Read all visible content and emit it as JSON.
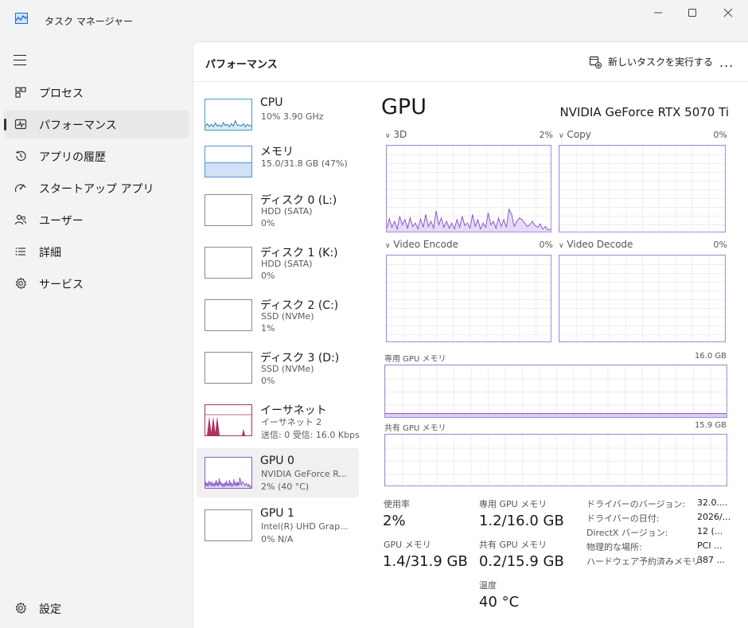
{
  "window": {
    "title": "タスク マネージャー",
    "controls": [
      "minimize-icon",
      "maximize-icon",
      "close-icon"
    ]
  },
  "nav": {
    "items": [
      {
        "label": "プロセス",
        "icon": "processes-icon"
      },
      {
        "label": "パフォーマンス",
        "icon": "performance-icon",
        "selected": true
      },
      {
        "label": "アプリの履歴",
        "icon": "history-icon"
      },
      {
        "label": "スタートアップ アプリ",
        "icon": "startup-icon"
      },
      {
        "label": "ユーザー",
        "icon": "users-icon"
      },
      {
        "label": "詳細",
        "icon": "details-icon"
      },
      {
        "label": "サービス",
        "icon": "services-icon"
      }
    ],
    "settings_label": "設定"
  },
  "header": {
    "title": "パフォーマンス",
    "run_task_label": "新しいタスクを実行する",
    "more_label": "..."
  },
  "resources": [
    {
      "name": "CPU",
      "sub1": "10%  3.90 GHz",
      "sub2": "",
      "sub3": "",
      "utilization": [
        0.12,
        0.2,
        0.1,
        0.18,
        0.1,
        0.22,
        0.12,
        0.16,
        0.1,
        0.24,
        0.14,
        0.18,
        0.1,
        0.2,
        0.12,
        0.3,
        0.14,
        0.16,
        0.12,
        0.2,
        0.1,
        0.18,
        0.12,
        0.14
      ]
    },
    {
      "name": "メモリ",
      "sub1": "15.0/31.8 GB (47%)",
      "sub2": "",
      "sub3": "",
      "utilization": [
        0.47
      ]
    },
    {
      "name": "ディスク 0 (L:)",
      "sub1": "HDD (SATA)",
      "sub2": "0%",
      "sub3": "",
      "utilization": []
    },
    {
      "name": "ディスク 1 (K:)",
      "sub1": "HDD (SATA)",
      "sub2": "0%",
      "sub3": "",
      "utilization": []
    },
    {
      "name": "ディスク 2 (C:)",
      "sub1": "SSD (NVMe)",
      "sub2": "1%",
      "sub3": "",
      "utilization": []
    },
    {
      "name": "ディスク 3 (D:)",
      "sub1": "SSD (NVMe)",
      "sub2": "0%",
      "sub3": "",
      "utilization": []
    },
    {
      "name": "イーサネット",
      "sub1": "イーサネット 2",
      "sub2": "送信: 0  受信: 16.0 Kbps",
      "sub3": "",
      "utilization": []
    },
    {
      "name": "GPU 0",
      "sub1": "NVIDIA GeForce R...",
      "sub2": "2% (40 °C)",
      "sub3": "",
      "selected": true,
      "utilization": []
    },
    {
      "name": "GPU 1",
      "sub1": "Intel(R) UHD Grap...",
      "sub2": "0%  N/A",
      "sub3": "",
      "utilization": []
    }
  ],
  "gpu": {
    "title": "GPU",
    "model": "NVIDIA GeForce RTX 5070 Ti",
    "engines": [
      {
        "label": "3D",
        "pct": "2%"
      },
      {
        "label": "Copy",
        "pct": "0%"
      },
      {
        "label": "Video Encode",
        "pct": "0%"
      },
      {
        "label": "Video Decode",
        "pct": "0%"
      }
    ],
    "dedicated_mem": {
      "label": "専用 GPU メモリ",
      "max": "16.0 GB",
      "fill_fraction": 0.075
    },
    "shared_mem": {
      "label": "共有 GPU メモリ",
      "max": "15.9 GB",
      "fill_fraction": 0.0
    },
    "stats": [
      {
        "label": "使用率",
        "value": "2%"
      },
      {
        "label": "専用 GPU メモリ",
        "value": "1.2/16.0 GB"
      },
      {
        "label": "GPU メモリ",
        "value": "1.4/31.9 GB"
      },
      {
        "label": "共有 GPU メモリ",
        "value": "0.2/15.9 GB"
      },
      {
        "label": "温度",
        "value": "40 °C"
      }
    ],
    "details": [
      {
        "key": "ドライバーのバージョン:",
        "value": "32.0...."
      },
      {
        "key": "ドライバーの日付:",
        "value": "2026/..."
      },
      {
        "key": "DirectX バージョン:",
        "value": "12 (..."
      },
      {
        "key": "物理的な場所:",
        "value": "PCI ..."
      },
      {
        "key": "ハードウェア予約済みメモリ:",
        "value": "387 ..."
      }
    ],
    "activity_3d": [
      0.04,
      0.15,
      0.05,
      0.12,
      0.03,
      0.18,
      0.08,
      0.14,
      0.04,
      0.16,
      0.06,
      0.1,
      0.03,
      0.15,
      0.05,
      0.2,
      0.06,
      0.12,
      0.04,
      0.24,
      0.08,
      0.16,
      0.05,
      0.12,
      0.04,
      0.1,
      0.03,
      0.14,
      0.05,
      0.18,
      0.07,
      0.1,
      0.04,
      0.2,
      0.06,
      0.14,
      0.03,
      0.1,
      0.05,
      0.22,
      0.08,
      0.12,
      0.04,
      0.16,
      0.06,
      0.14,
      0.05,
      0.26,
      0.2,
      0.06,
      0.12,
      0.16,
      0.14,
      0.1,
      0.06,
      0.08,
      0.12,
      0.07,
      0.05,
      0.09,
      0.03,
      0.06,
      0.02,
      0.03
    ],
    "colors": {
      "accent": "#a78bdb",
      "accent_fill": "#e6dbf7",
      "line": "#8b5cc7",
      "eth": "#b03060",
      "mem": "#5b8fd6"
    }
  }
}
